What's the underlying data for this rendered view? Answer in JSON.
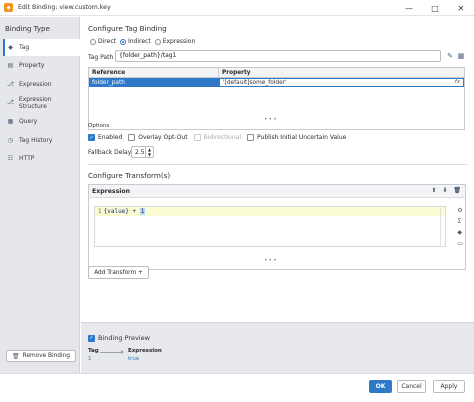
{
  "window": {
    "title": "Edit Binding: view.custom.key",
    "minimize": "—",
    "maximize": "□",
    "close": "✕"
  },
  "sidebar": {
    "header": "Binding Type",
    "items": [
      {
        "label": "Tag",
        "icon": "tag-icon",
        "glyph": "◆",
        "active": true
      },
      {
        "label": "Property",
        "icon": "property-icon",
        "glyph": "▤",
        "active": false
      },
      {
        "label": "Expression",
        "icon": "expression-icon",
        "glyph": "⎇",
        "active": false
      },
      {
        "label": "Expression Structure",
        "icon": "expression-structure-icon",
        "glyph": "⎇",
        "active": false
      },
      {
        "label": "Query",
        "icon": "query-icon",
        "glyph": "▦",
        "active": false
      },
      {
        "label": "Tag History",
        "icon": "tag-history-icon",
        "glyph": "◷",
        "active": false
      },
      {
        "label": "HTTP",
        "icon": "http-icon",
        "glyph": "☷",
        "active": false
      }
    ],
    "remove_button": "Remove Binding"
  },
  "tag_binding": {
    "title": "Configure Tag Binding",
    "modes": [
      {
        "label": "Direct",
        "selected": false
      },
      {
        "label": "Indirect",
        "selected": true
      },
      {
        "label": "Expression",
        "selected": false
      }
    ],
    "tag_path_label": "Tag Path",
    "tag_path_value": "{folder_path}/tag1",
    "references": {
      "columns": [
        "Reference",
        "Property"
      ],
      "rows": [
        {
          "reference": "folder_path",
          "property": "'[default]some_folder'"
        }
      ],
      "fx_label": "fx"
    },
    "grip": "•••",
    "options_label": "Options",
    "options": [
      {
        "label": "Enabled",
        "checked": true,
        "disabled": false
      },
      {
        "label": "Overlay Opt-Out",
        "checked": false,
        "disabled": false
      },
      {
        "label": "Bidirectional",
        "checked": false,
        "disabled": true
      },
      {
        "label": "Publish Initial Uncertain Value",
        "checked": false,
        "disabled": false
      }
    ],
    "fallback_label": "Fallback Delay",
    "fallback_value": "2.5"
  },
  "transforms": {
    "title": "Configure Transform(s)",
    "box_title": "Expression",
    "code": {
      "line": "1",
      "token": "{value}",
      "operator": " + ",
      "number": "1"
    },
    "add_button": "Add Transform +"
  },
  "preview": {
    "title": "Binding Preview",
    "checked": true,
    "tag_label": "Tag",
    "tag_value": "1",
    "expr_label": "Expression",
    "expr_value": "true"
  },
  "footer": {
    "ok": "OK",
    "cancel": "Cancel",
    "apply": "Apply"
  },
  "colors": {
    "accent": "#2f79c9",
    "sidebar_bg": "#e6e7ea",
    "app_icon": "#f7931e"
  }
}
